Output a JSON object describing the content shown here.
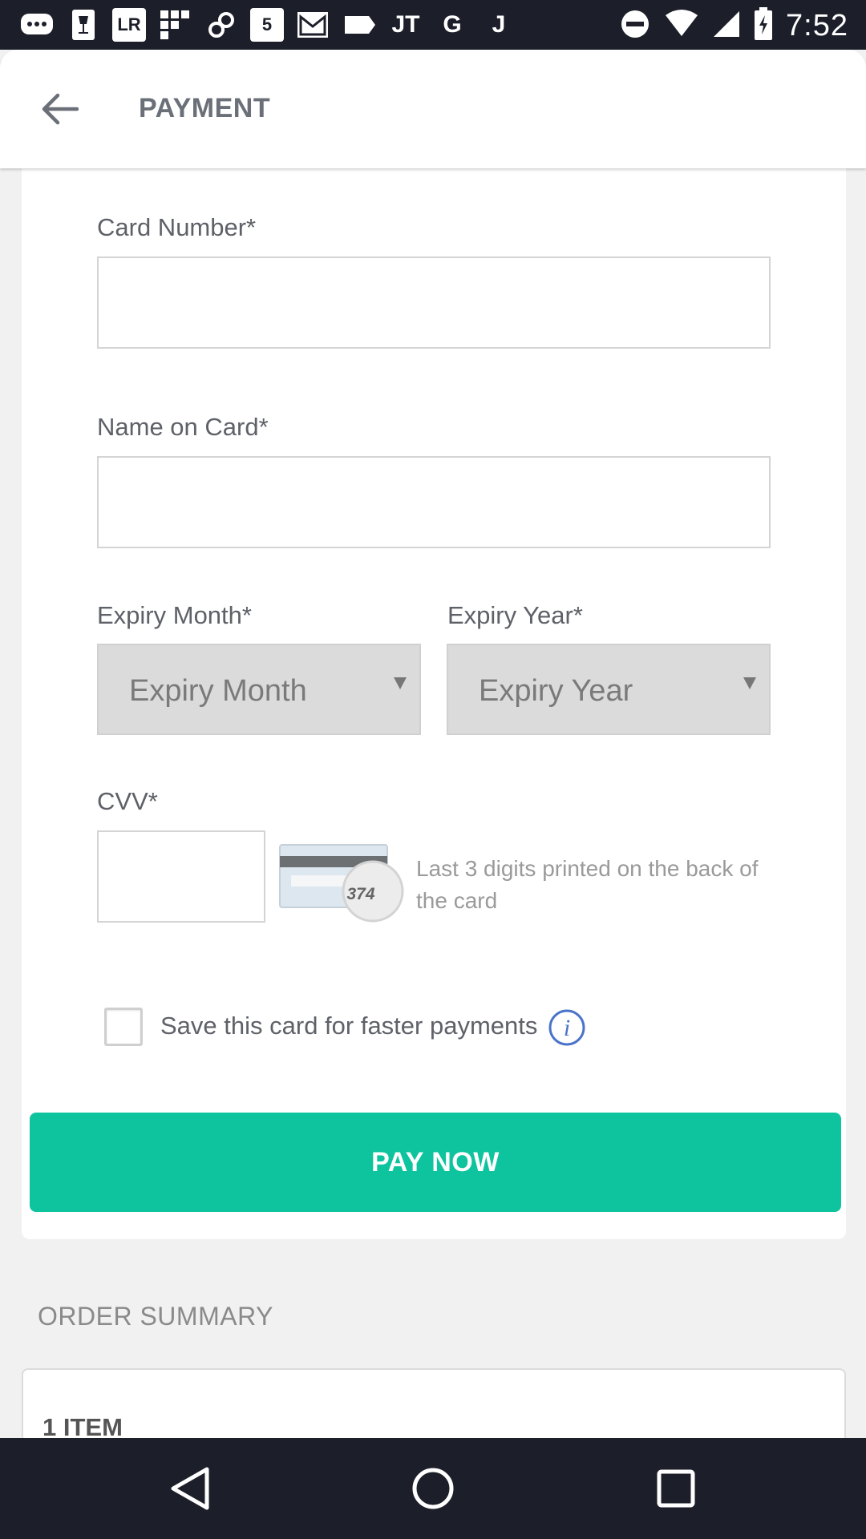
{
  "status_bar": {
    "time": "7:52",
    "left_icons": [
      "chat-bubble-icon",
      "wine-icon",
      "lr-app-icon",
      "grid-app-icon",
      "link-app-icon",
      "five-app-icon",
      "gmail-icon",
      "tag-icon",
      "jt-app-icon",
      "google-icon",
      "j-app-icon"
    ],
    "lr_text": "LR",
    "five_text": "5",
    "jt_text": "JT",
    "g_text": "G",
    "j_text": "J"
  },
  "app_bar": {
    "title": "PAYMENT"
  },
  "form": {
    "card_number_label": "Card Number*",
    "card_number_value": "",
    "name_label": "Name on Card*",
    "name_value": "",
    "expiry_month_label": "Expiry Month*",
    "expiry_month_value": "Expiry Month",
    "expiry_year_label": "Expiry Year*",
    "expiry_year_value": "Expiry Year",
    "cvv_label": "CVV*",
    "cvv_value": "",
    "cvv_card_number": "374",
    "cvv_help": "Last 3 digits printed on the back of the card",
    "save_card_label": "Save this card for faster payments",
    "save_card_checked": false,
    "info_icon_text": "i",
    "pay_button": "PAY NOW"
  },
  "order_summary": {
    "title": "ORDER SUMMARY",
    "items_label": "1 ITEM"
  },
  "colors": {
    "accent": "#0ec49f",
    "status_bar": "#1c1f2a",
    "info": "#4a73c9"
  }
}
